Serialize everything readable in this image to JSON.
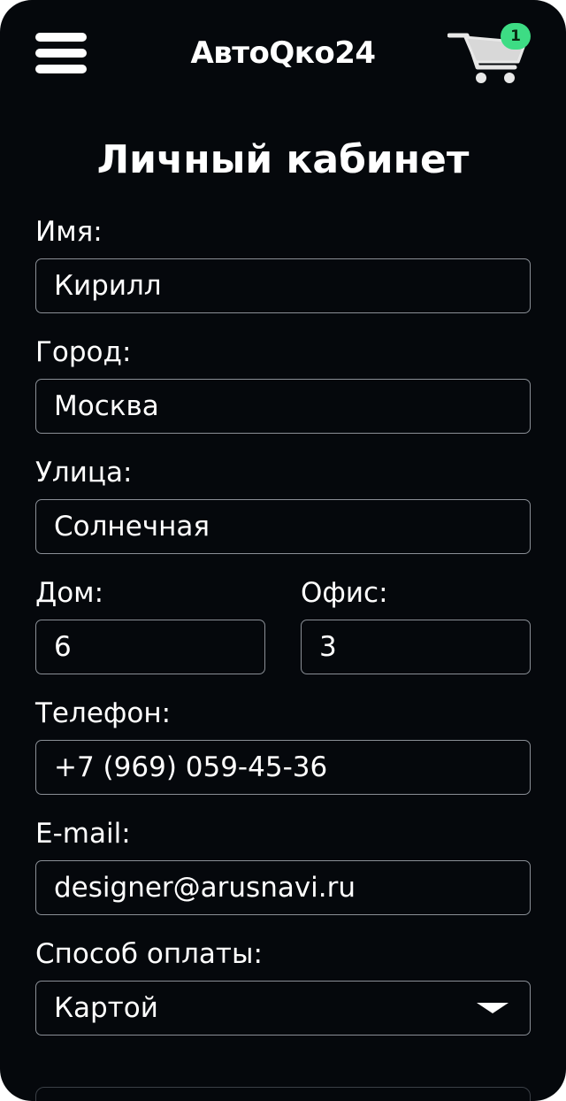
{
  "header": {
    "menu_icon": "hamburger-menu-icon",
    "logo": "АвтоQко24",
    "cart_icon": "shopping-cart-icon",
    "cart_count": "1",
    "badge_color": "#3ddc84"
  },
  "page": {
    "title": "Личный кабинет"
  },
  "form": {
    "name": {
      "label": "Имя:",
      "value": "Кирилл"
    },
    "city": {
      "label": "Город:",
      "value": "Москва"
    },
    "street": {
      "label": "Улица:",
      "value": "Солнечная"
    },
    "house": {
      "label": "Дом:",
      "value": "6"
    },
    "office": {
      "label": "Офис:",
      "value": "3"
    },
    "phone": {
      "label": "Телефон:",
      "value": "+7 (969) 059-45-36"
    },
    "email": {
      "label": "E-mail:",
      "value": "designer@arusnavi.ru"
    },
    "payment": {
      "label": "Способ оплаты:",
      "value": "Картой",
      "arrow_icon": "dropdown-arrow-icon"
    }
  }
}
